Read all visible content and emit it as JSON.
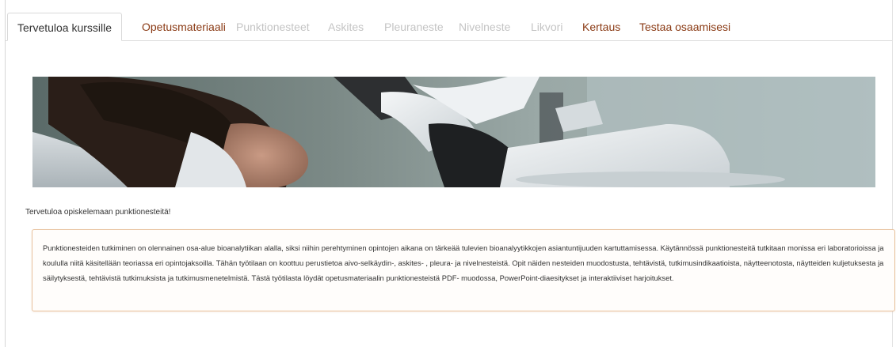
{
  "tabs": [
    {
      "label": "Tervetuloa kurssille",
      "state": "active"
    },
    {
      "label": "Opetusmateriaali",
      "state": "link"
    },
    {
      "label": "Punktionesteet",
      "state": "disabled"
    },
    {
      "label": "Askites",
      "state": "disabled"
    },
    {
      "label": "Pleuraneste",
      "state": "disabled"
    },
    {
      "label": "Nivelneste",
      "state": "disabled"
    },
    {
      "label": "Likvori",
      "state": "disabled"
    },
    {
      "label": "Kertaus",
      "state": "link"
    },
    {
      "label": "Testaa osaamisesi",
      "state": "link"
    }
  ],
  "content": {
    "welcome": "Tervetuloa opiskelemaan punktionesteitä!",
    "intro": "Punktionesteiden tutkiminen on olennainen osa-alue bioanalytiikan alalla, siksi niihin perehtyminen opintojen aikana on tärkeää tulevien bioanalyytikkojen asiantuntijuuden kartuttamisessa. Käytännössä punktionesteitä tutkitaan monissa eri laboratorioissa ja koululla niitä käsitellään teoriassa eri opintojaksoilla. Tähän työtilaan on koottuu perustietoa aivo-selkäydin-, askites- , pleura-  ja nivelnesteistä. Opit näiden nesteiden muodostusta, tehtävistä, tutkimusindikaatioista, näytteenotosta, näytteiden kuljetuksesta ja säilytyksestä, tehtävistä tutkimuksista ja tutkimusmenetelmistä. Tästä työtilasta löydät opetusmateriaalin punktionesteistä PDF- muodossa, PowerPoint-diaesitykset ja interaktiiviset harjoitukset."
  },
  "colors": {
    "link_tab": "#8a3a14",
    "disabled_tab": "#c4c4c4",
    "box_border": "#e8c19c"
  }
}
